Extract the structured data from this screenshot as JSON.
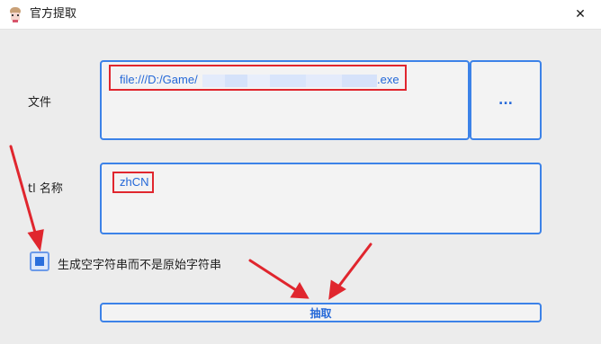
{
  "window": {
    "title": "官方提取",
    "close_glyph": "✕"
  },
  "form": {
    "file_label": "文件",
    "file_path_prefix": "file:///D:/Game/",
    "file_path_suffix": ".exe",
    "browse_label": "...",
    "tl_label": "tl 名称",
    "tl_value": "zhCN",
    "checkbox_label": "生成空字符串而不是原始字符串",
    "checkbox_checked": true,
    "extract_label": "抽取"
  },
  "colors": {
    "accent": "#3c82e8",
    "annotation": "#e0262e"
  },
  "icons": {
    "app": "app-icon",
    "close": "close-icon"
  }
}
